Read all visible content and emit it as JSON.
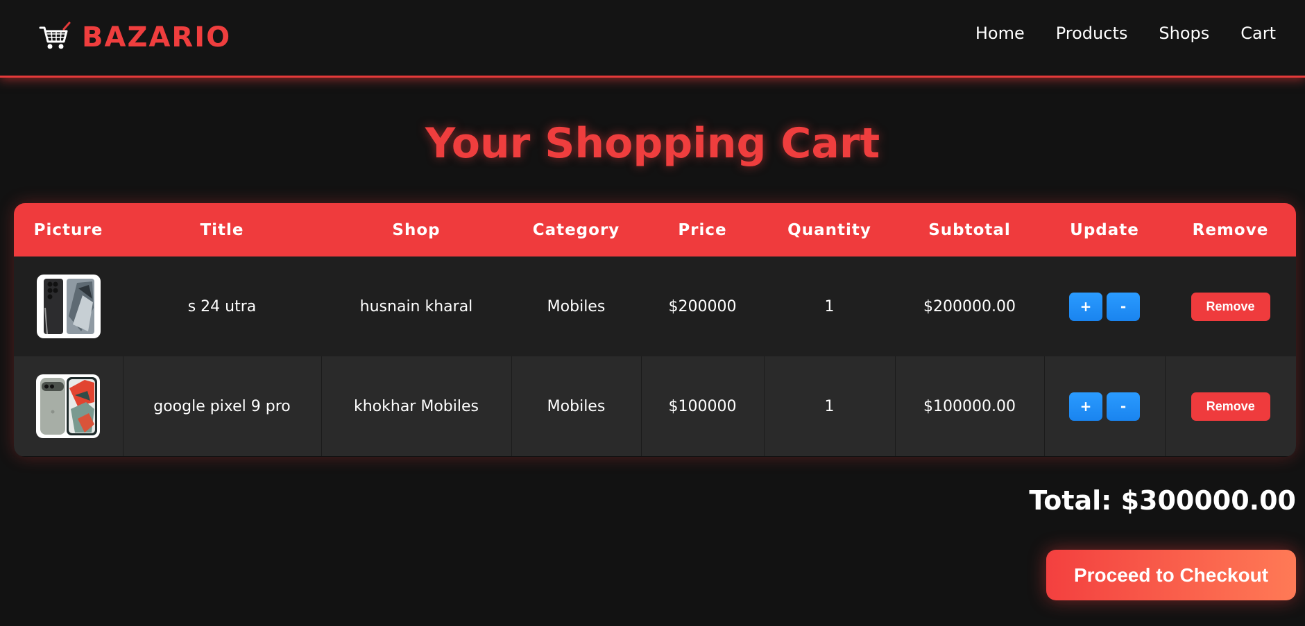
{
  "brand": {
    "name": "BAZARIO",
    "logo_icon": "shopping-cart-icon",
    "accent_color": "#ef3e3e"
  },
  "nav": {
    "links": [
      "Home",
      "Products",
      "Shops",
      "Cart"
    ]
  },
  "page": {
    "title": "Your Shopping Cart"
  },
  "cart": {
    "columns": [
      "Picture",
      "Title",
      "Shop",
      "Category",
      "Price",
      "Quantity",
      "Subtotal",
      "Update",
      "Remove"
    ],
    "items": [
      {
        "picture_icon": "phone-image",
        "title": "s 24 utra",
        "shop": "husnain kharal",
        "category": "Mobiles",
        "price": "$200000",
        "quantity": "1",
        "subtotal": "$200000.00",
        "increase_label": "+",
        "decrease_label": "-",
        "remove_label": "Remove"
      },
      {
        "picture_icon": "phone-image",
        "title": "google pixel 9 pro",
        "shop": "khokhar Mobiles",
        "category": "Mobiles",
        "price": "$100000",
        "quantity": "1",
        "subtotal": "$100000.00",
        "increase_label": "+",
        "decrease_label": "-",
        "remove_label": "Remove"
      }
    ]
  },
  "summary": {
    "total": "Total: $300000.00",
    "checkout_label": "Proceed to Checkout"
  },
  "colors": {
    "header_row": "#ef3b3d",
    "update_button": "#1a84ef",
    "remove_button": "#ef3b3d",
    "background": "#121212"
  }
}
